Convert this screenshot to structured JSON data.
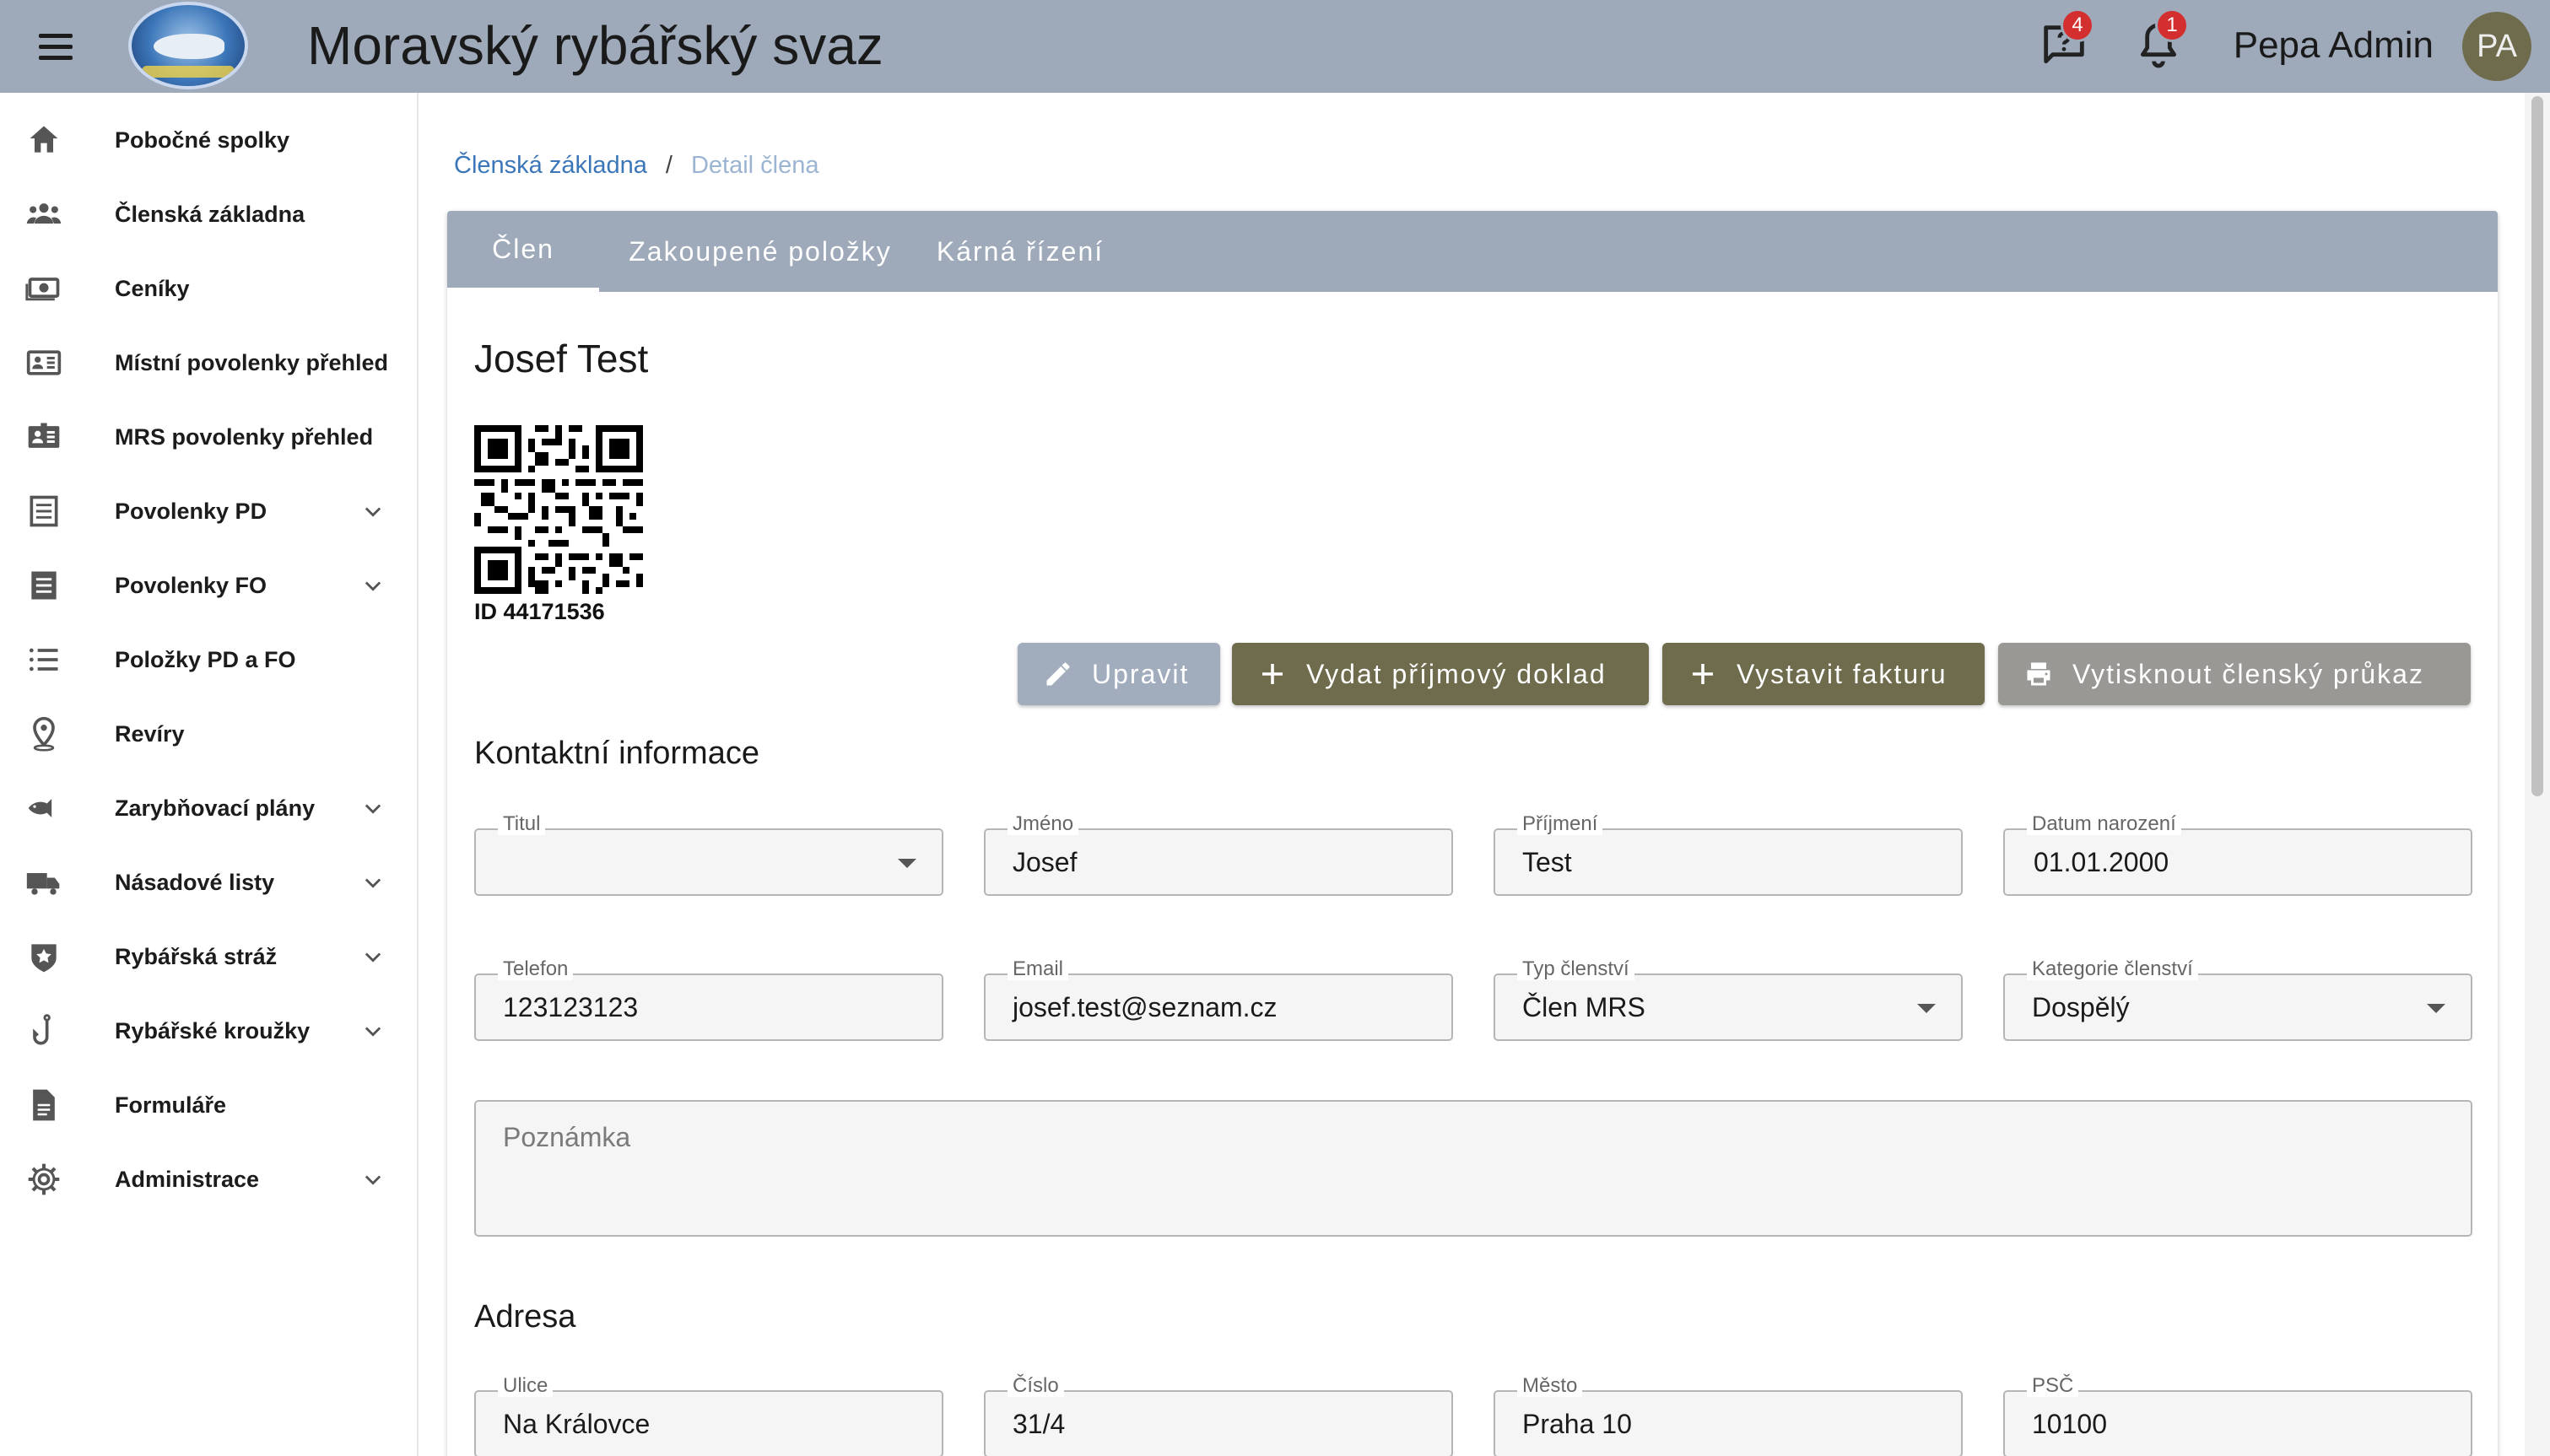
{
  "app": {
    "title": "Moravský rybářský svaz"
  },
  "header": {
    "messages_badge": "4",
    "notifications_badge": "1",
    "user_name": "Pepa Admin",
    "avatar_initials": "PA"
  },
  "sidebar": {
    "items": [
      {
        "label": "Pobočné spolky",
        "icon": "home-icon",
        "expandable": false
      },
      {
        "label": "Členská základna",
        "icon": "people-icon",
        "expandable": false
      },
      {
        "label": "Ceníky",
        "icon": "money-icon",
        "expandable": false
      },
      {
        "label": "Místní povolenky přehled",
        "icon": "id-card-icon",
        "expandable": false
      },
      {
        "label": "MRS povolenky přehled",
        "icon": "id-card-filled-icon",
        "expandable": false
      },
      {
        "label": "Povolenky PD",
        "icon": "document-list-icon",
        "expandable": true
      },
      {
        "label": "Povolenky FO",
        "icon": "document-list-icon",
        "expandable": true
      },
      {
        "label": "Položky PD a FO",
        "icon": "list-icon",
        "expandable": false
      },
      {
        "label": "Revíry",
        "icon": "location-icon",
        "expandable": false
      },
      {
        "label": "Zarybňovací plány",
        "icon": "fish-icon",
        "expandable": true
      },
      {
        "label": "Násadové listy",
        "icon": "truck-icon",
        "expandable": true
      },
      {
        "label": "Rybářská stráž",
        "icon": "badge-icon",
        "expandable": true
      },
      {
        "label": "Rybářské kroužky",
        "icon": "hook-icon",
        "expandable": true
      },
      {
        "label": "Formuláře",
        "icon": "file-icon",
        "expandable": false
      },
      {
        "label": "Administrace",
        "icon": "gear-icon",
        "expandable": true
      }
    ]
  },
  "breadcrumb": {
    "parent": "Členská základna",
    "separator": "/",
    "current": "Detail člena"
  },
  "tabs": [
    {
      "label": "Člen",
      "active": true
    },
    {
      "label": "Zakoupené položky",
      "active": false
    },
    {
      "label": "Kárná řízení",
      "active": false
    }
  ],
  "member": {
    "name": "Josef Test",
    "qr_id": "ID 44171536"
  },
  "actions": {
    "edit": "Upravit",
    "receipt": "Vydat příjmový doklad",
    "invoice": "Vystavit fakturu",
    "print_card": "Vytisknout členský průkaz"
  },
  "contact": {
    "section_title": "Kontaktní informace",
    "title_label": "Titul",
    "title_value": "",
    "first_name_label": "Jméno",
    "first_name": "Josef",
    "last_name_label": "Příjmení",
    "last_name": "Test",
    "birth_label": "Datum narození",
    "birth_date": "01.01.2000",
    "phone_label": "Telefon",
    "phone": "123123123",
    "email_label": "Email",
    "email": "josef.test@seznam.cz",
    "membership_type_label": "Typ členství",
    "membership_type": "Člen MRS",
    "membership_category_label": "Kategorie členství",
    "membership_category": "Dospělý",
    "note_placeholder": "Poznámka"
  },
  "address": {
    "section_title": "Adresa",
    "street_label": "Ulice",
    "street": "Na Královce",
    "number_label": "Číslo",
    "number": "31/4",
    "city_label": "Město",
    "city": "Praha 10",
    "zip_label": "PSČ",
    "zip": "10100"
  },
  "colors": {
    "appbar": "#9ea9b9",
    "olive_button": "#6e6c4c",
    "edit_button": "#a1acbd",
    "print_button": "#9a9895",
    "link": "#3b76b8",
    "badge": "#d32f2f"
  }
}
